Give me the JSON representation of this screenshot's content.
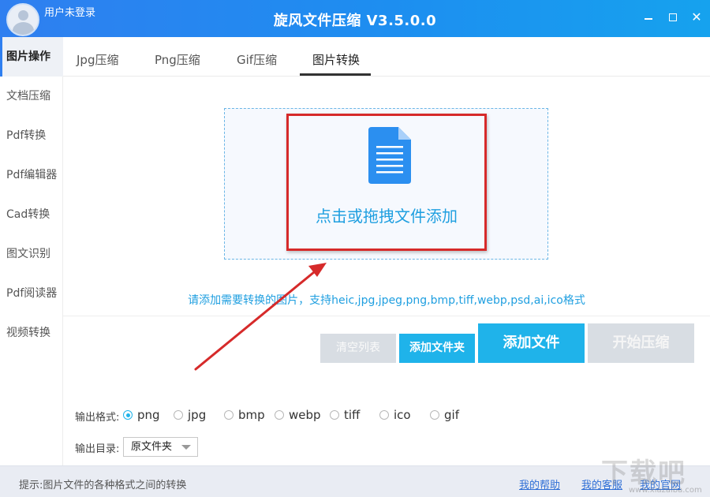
{
  "window": {
    "title": "旋风文件压缩 V3.5.0.0",
    "user_label": "用户未登录",
    "controls": [
      "minimize-icon",
      "maximize-icon",
      "close-icon"
    ]
  },
  "sidebar": {
    "items": [
      {
        "label": "图片操作",
        "active": true
      },
      {
        "label": "文档压缩"
      },
      {
        "label": "Pdf转换"
      },
      {
        "label": "Pdf编辑器"
      },
      {
        "label": "Cad转换"
      },
      {
        "label": "图文识别"
      },
      {
        "label": "Pdf阅读器"
      },
      {
        "label": "视频转换"
      }
    ]
  },
  "tabs": [
    {
      "label": "Jpg压缩"
    },
    {
      "label": "Png压缩"
    },
    {
      "label": "Gif压缩"
    },
    {
      "label": "图片转换",
      "active": true
    }
  ],
  "dropzone": {
    "label": "点击或拖拽文件添加",
    "icon": "document-icon"
  },
  "hint": "请添加需要转换的图片，支持heic,jpg,jpeg,png,bmp,tiff,webp,psd,ai,ico格式",
  "buttons": {
    "clear": "清空列表",
    "add_folder": "添加文件夹",
    "add_file": "添加文件",
    "start": "开始压缩"
  },
  "output_format": {
    "label": "输出格式:",
    "options": [
      "png",
      "jpg",
      "bmp",
      "webp",
      "tiff",
      "ico",
      "gif"
    ],
    "selected": "png"
  },
  "output_dir": {
    "label": "输出目录:",
    "value": "原文件夹"
  },
  "footer": {
    "hint": "提示:图片文件的各种格式之间的转换",
    "links": [
      "我的帮助",
      "我的客服",
      "我的官网"
    ]
  },
  "watermark": {
    "text": "下载吧",
    "url": "www.xiazaiba.com"
  },
  "colors": {
    "titlebar": "#1d8ef0",
    "accent": "#1fb3ea",
    "disabled": "#d8dde3",
    "annotation": "#d62a2a",
    "link": "#2f6fd6"
  }
}
